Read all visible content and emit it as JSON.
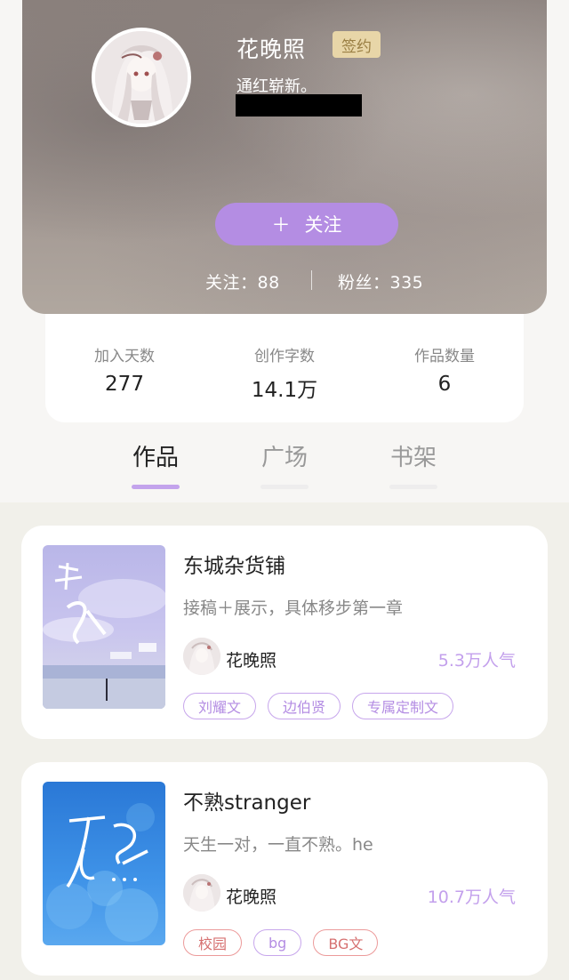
{
  "profile": {
    "name": "花晚照",
    "sign_badge": "签约",
    "bio": "通红崭新。",
    "follow_button": "关注",
    "follow_icon": "plus-icon",
    "following_label": "关注：88",
    "fans_label": "粉丝：335"
  },
  "stats": [
    {
      "label": "加入天数",
      "value": "277"
    },
    {
      "label": "创作字数",
      "value": "14.1万"
    },
    {
      "label": "作品数量",
      "value": "6"
    }
  ],
  "tabs": [
    {
      "label": "作品",
      "active": true
    },
    {
      "label": "广场",
      "active": false
    },
    {
      "label": "书架",
      "active": false
    }
  ],
  "books": [
    {
      "title": "东城杂货铺",
      "desc": "接稿＋展示，具体移步第一章",
      "author": "花晚照",
      "popularity": "5.3万人气",
      "tags": [
        "刘耀文",
        "边伯贤",
        "专属定制文"
      ]
    },
    {
      "title": "不熟stranger",
      "desc": "天生一对，一直不熟。he",
      "author": "花晚照",
      "popularity": "10.7万人气",
      "tags": [
        "校园",
        "bg",
        "BG文"
      ]
    }
  ],
  "colors": {
    "accent": "#b48de3",
    "tag_red": "#d67070",
    "sign_badge_bg": "#e8d6a8"
  }
}
